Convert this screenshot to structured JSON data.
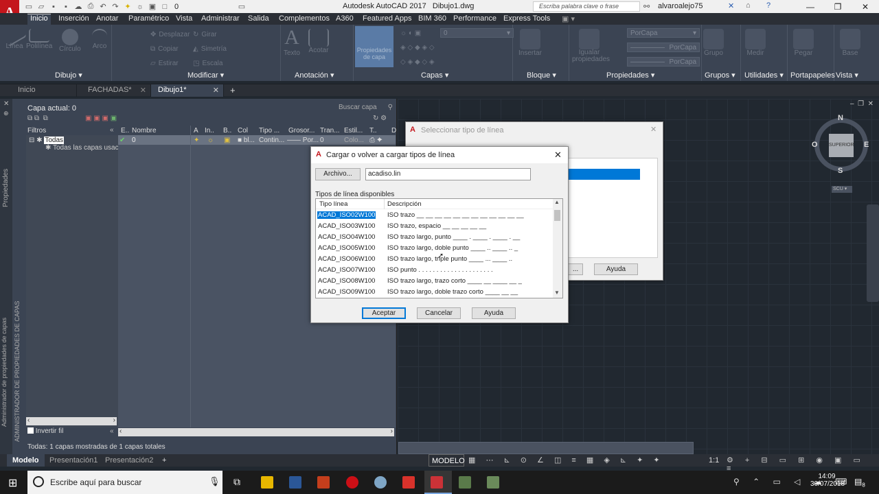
{
  "title_bar": {
    "app_title": "Autodesk AutoCAD 2017",
    "file_title": "Dibujo1.dwg",
    "layer_value": "0",
    "search_placeholder": "Escriba palabra clave o frase",
    "username": "alvaroalejo75"
  },
  "menu_tabs": [
    "Inicio",
    "Inserción",
    "Anotar",
    "Paramétrico",
    "Vista",
    "Administrar",
    "Salida",
    "Complementos",
    "A360",
    "Featured Apps",
    "BIM 360",
    "Performance",
    "Express Tools"
  ],
  "ribbon": {
    "groups": {
      "dibujo": "Dibujo",
      "modificar": "Modificar",
      "anotacion": "Anotación",
      "capas": "Capas",
      "bloque": "Bloque",
      "propiedades": "Propiedades",
      "grupos": "Grupos",
      "utilidades": "Utilidades",
      "portapapeles": "Portapapeles",
      "vista": "Vista"
    },
    "draw_tools": [
      "Línea",
      "Polilínea",
      "Círculo",
      "Arco"
    ],
    "modify_tools": [
      "Desplazar",
      "Girar",
      "Copiar",
      "Simetría",
      "Estirar",
      "Escala"
    ],
    "annotation_tools": [
      "Texto",
      "Acotar"
    ],
    "layer_props_label": "Propiedades de capa",
    "layer_value": "0",
    "block_tool": "Insertar",
    "match_props": "Igualar propiedades",
    "prop_values": [
      "PorCapa",
      "PorCapa",
      "PorCapa"
    ],
    "group_tool": "Grupo",
    "measure_tool": "Medir",
    "paste_tool": "Pegar",
    "base_tool": "Base"
  },
  "file_tabs": [
    "Inicio",
    "FACHADAS*",
    "Dibujo1*"
  ],
  "layer_manager": {
    "current_layer": "Capa actual: 0",
    "search_placeholder": "Buscar capa",
    "filters_label": "Filtros",
    "filter_root": "Todas",
    "filter_child": "Todas las capas usac",
    "columns": [
      "E..",
      "Nombre",
      "A",
      "In..",
      "B..",
      "Col",
      "Tipo ...",
      "Grosor...",
      "Tran...",
      "Estil...",
      "T..",
      "D"
    ],
    "row": {
      "name": "0",
      "color": "bl...",
      "linetype": "Contin...",
      "lineweight": "—— Por...",
      "transparency": "0",
      "style": "Colo..."
    },
    "invert_filter": "Invertir fil",
    "status": "Todas: 1 capas mostradas de 1 capas totales",
    "side_title": "ADMINISTRADOR DE PROPIEDADES DE CAPAS",
    "side_title2": "Administrador de propiedades de capas",
    "side_props": "Propiedades"
  },
  "viewcube": {
    "north": "N",
    "south": "S",
    "east": "E",
    "west": "O",
    "face": "SUPERIOR",
    "ucs": "SCU"
  },
  "select_linetype_dialog": {
    "title": "Seleccionar tipo de línea",
    "help_button": "Ayuda"
  },
  "load_linetype_dialog": {
    "title": "Cargar o volver a cargar tipos de línea",
    "file_button": "Archivo...",
    "file_value": "acadiso.lin",
    "available_label": "Tipos de línea disponibles",
    "col_type": "Tipo línea",
    "col_desc": "Descripción",
    "linetypes": [
      {
        "name": "ACAD_ISO02W100",
        "desc": "ISO trazo __ __ __ __ __ __ __ __ __ __ __ __"
      },
      {
        "name": "ACAD_ISO03W100",
        "desc": "ISO trazo, espacio __    __    __    __    __"
      },
      {
        "name": "ACAD_ISO04W100",
        "desc": "ISO trazo largo, punto ____ . ____ . ____ . __"
      },
      {
        "name": "ACAD_ISO05W100",
        "desc": "ISO trazo largo, doble punto ____ .. ____ .. _"
      },
      {
        "name": "ACAD_ISO06W100",
        "desc": "ISO trazo largo, triple punto ____ ... ____ .."
      },
      {
        "name": "ACAD_ISO07W100",
        "desc": "ISO punto . . . . . . . . . . . . . . . . . . . . ."
      },
      {
        "name": "ACAD_ISO08W100",
        "desc": "ISO trazo largo, trazo corto ____ __ ____ __ _"
      },
      {
        "name": "ACAD_ISO09W100",
        "desc": "ISO trazo largo, doble trazo corto ____ __ __"
      }
    ],
    "selected_index": 0,
    "ok_button": "Aceptar",
    "cancel_button": "Cancelar",
    "help_button": "Ayuda"
  },
  "layout_tabs": [
    "Modelo",
    "Presentación1",
    "Presentación2"
  ],
  "status_bar": {
    "model": "MODELO",
    "scale": "1:1"
  },
  "taskbar": {
    "search_placeholder": "Escribe aquí para buscar",
    "time": "14:09",
    "date": "30/07/2018",
    "notif_count": "8"
  },
  "colors": {
    "accent": "#0078d7",
    "autocad_red": "#c4161c",
    "ribbon_bg": "#3b4453",
    "canvas_bg": "#212830"
  }
}
